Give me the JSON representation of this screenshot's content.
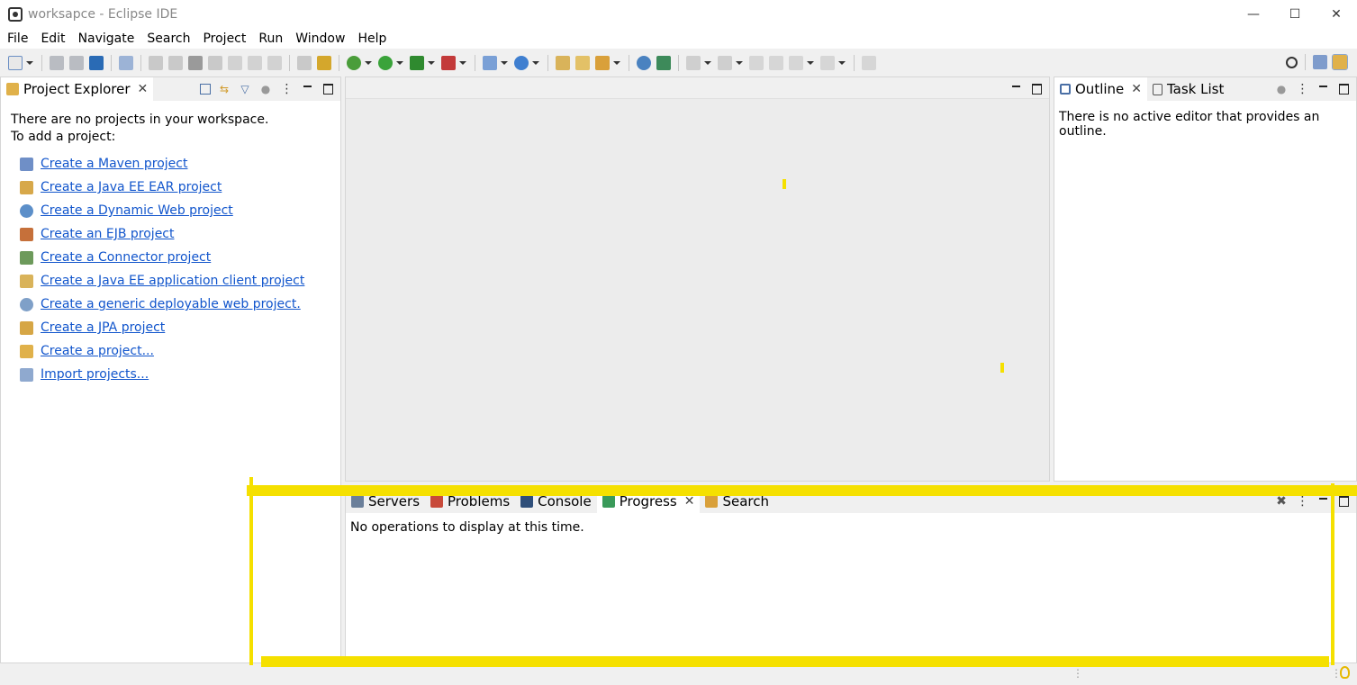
{
  "window": {
    "title": "worksapce - Eclipse IDE",
    "minimize": "—",
    "maximize": "☐",
    "close": "✕"
  },
  "menu": [
    "File",
    "Edit",
    "Navigate",
    "Search",
    "Project",
    "Run",
    "Window",
    "Help"
  ],
  "project_explorer": {
    "tab_label": "Project Explorer",
    "message_line1": "There are no projects in your workspace.",
    "message_line2": "To add a project:",
    "links": [
      "Create a Maven project",
      "Create a Java EE EAR project",
      "Create a Dynamic Web project",
      "Create an EJB project",
      "Create a Connector project",
      "Create a Java EE application client project",
      "Create a generic deployable web project.",
      "Create a JPA project",
      "Create a project...",
      "Import projects..."
    ]
  },
  "outline_panel": {
    "tabs": [
      "Outline",
      "Task List"
    ],
    "message": "There is no active editor that provides an outline."
  },
  "bottom_panel": {
    "tabs": [
      "Servers",
      "Problems",
      "Console",
      "Progress",
      "Search"
    ],
    "active_tab": "Progress",
    "message": "No operations to display at this time."
  },
  "colors": {
    "link": "#1155cc",
    "highlight": "#f5e000"
  }
}
